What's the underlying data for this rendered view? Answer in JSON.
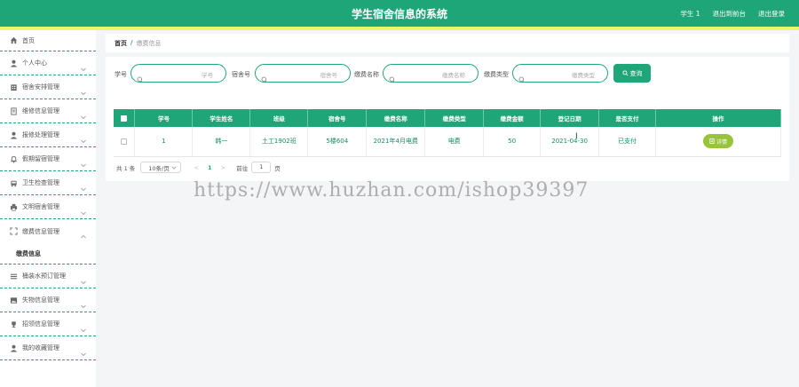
{
  "header": {
    "title": "学生宿舍信息的系统",
    "links": [
      "学生 1",
      "退出到前台",
      "退出登录"
    ]
  },
  "sidebar": {
    "items": [
      {
        "label": "首页",
        "icon": "home-icon",
        "chevron": false
      },
      {
        "label": "个人中心",
        "icon": "user-icon",
        "chevron": true
      },
      {
        "label": "宿舍安排管理",
        "icon": "building-icon",
        "chevron": true
      },
      {
        "label": "维修信息管理",
        "icon": "document-icon",
        "chevron": true
      },
      {
        "label": "报修处理管理",
        "icon": "user-icon",
        "chevron": true
      },
      {
        "label": "假期留宿管理",
        "icon": "bell-icon",
        "chevron": true
      },
      {
        "label": "卫生检查管理",
        "icon": "bus-icon",
        "chevron": true
      },
      {
        "label": "文明宿舍管理",
        "icon": "printer-icon",
        "chevron": true
      },
      {
        "label": "缴费信息管理",
        "icon": "expand-icon",
        "chevron": true,
        "open": true
      }
    ],
    "sub_item": "缴费信息",
    "items_after": [
      {
        "label": "桶装水预订管理",
        "icon": "list-icon",
        "chevron": true
      },
      {
        "label": "失物信息管理",
        "icon": "image-icon",
        "chevron": true
      },
      {
        "label": "招领信息管理",
        "icon": "trophy-icon",
        "chevron": true
      },
      {
        "label": "我的收藏管理",
        "icon": "user-icon",
        "chevron": true
      }
    ]
  },
  "breadcrumb": {
    "home": "首页",
    "separator": "/",
    "current": "缴费信息"
  },
  "search": {
    "fields": [
      {
        "label": "学号",
        "placeholder": "学号"
      },
      {
        "label": "宿舍号",
        "placeholder": "宿舍号"
      },
      {
        "label": "缴费名称",
        "placeholder": "缴费名称"
      },
      {
        "label": "缴费类型",
        "placeholder": "缴费类型"
      }
    ],
    "button_label": "查询"
  },
  "table": {
    "columns": [
      "学号",
      "学生姓名",
      "班级",
      "宿舍号",
      "缴费名称",
      "缴费类型",
      "缴费金额",
      "登记日期",
      "是否支付",
      "操作"
    ],
    "rows": [
      {
        "cells": [
          "1",
          "韩一",
          "土工1902班",
          "5楼604",
          "2021年4月电费",
          "电费",
          "50",
          "2021-04-30",
          "已支付"
        ],
        "action": "详情"
      }
    ]
  },
  "pagination": {
    "total": "共 1 条",
    "page_size": "10条/页",
    "prev": "<",
    "current_page": "1",
    "next": ">",
    "goto_label": "前往",
    "goto_value": "1",
    "page_suffix": "页"
  },
  "watermark": "https://www.huzhan.com/ishop39397",
  "colors": {
    "primary": "#1ea679",
    "stripe": "#e9f86a",
    "detail": "#97c43a"
  }
}
